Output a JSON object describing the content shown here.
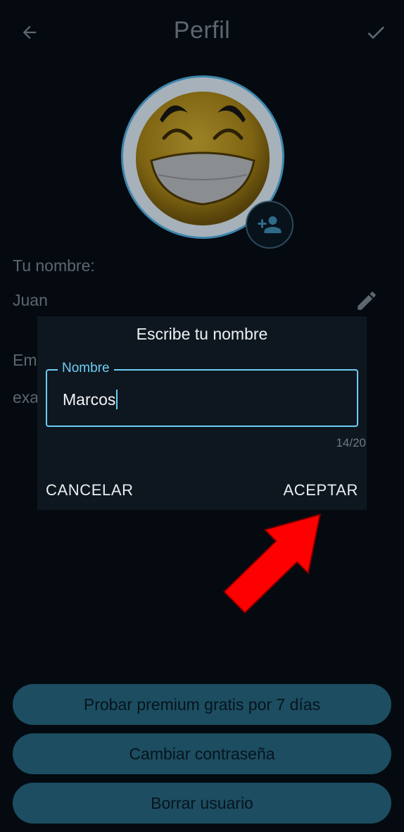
{
  "header": {
    "title": "Perfil",
    "back_icon": "arrow-left-icon",
    "confirm_icon": "check-icon"
  },
  "profile": {
    "avatar_icon": "laughing-emoji-avatar",
    "add_photo_icon": "person-add-icon",
    "name_label": "Tu nombre:",
    "name_value": "Juan",
    "email_label_partial": "Em",
    "email_value_partial": "exa",
    "edit_icon": "pencil-icon"
  },
  "dialog": {
    "title": "Escribe tu nombre",
    "input_label": "Nombre",
    "input_value": "Marcos",
    "counter": "14/20",
    "cancel_label": "CANCELAR",
    "accept_label": "ACEPTAR"
  },
  "actions": {
    "premium_label": "Probar premium gratis por 7 días",
    "change_password_label": "Cambiar contraseña",
    "delete_user_label": "Borrar usuario"
  },
  "annotation": {
    "arrow_color": "#ff0000",
    "arrow_icon": "red-pointer-arrow"
  },
  "colors": {
    "background": "#040a10",
    "dialog": "#0e171f",
    "accent": "#6ccef5",
    "button": "#1c4d61"
  }
}
